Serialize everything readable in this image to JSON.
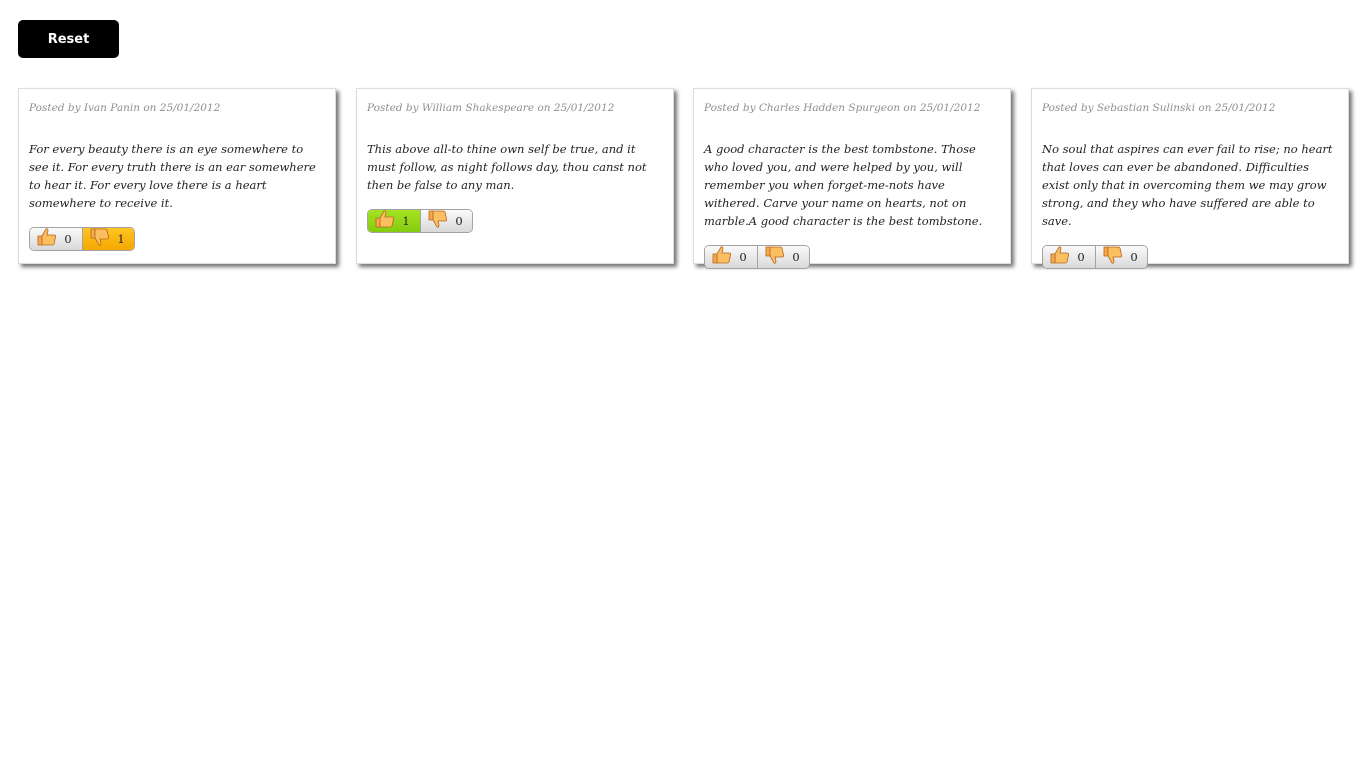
{
  "reset": {
    "label": "Reset"
  },
  "posts": [
    {
      "meta": "Posted by Ivan Panin on 25/01/2012",
      "text": "For every beauty there is an eye somewhere to see it. For every truth there is an ear somewhere to hear it. For every love there is a heart somewhere to receive it.",
      "likes": "0",
      "dislikes": "1",
      "active_vote": "down"
    },
    {
      "meta": "Posted by William Shakespeare on 25/01/2012",
      "text": "This above all-to thine own self be true, and it must follow, as night follows day, thou canst not then be false to any man.",
      "likes": "1",
      "dislikes": "0",
      "active_vote": "up"
    },
    {
      "meta": "Posted by Charles Hadden Spurgeon on 25/01/2012",
      "text": "A good character is the best tombstone. Those who loved you, and were helped by you, will remember you when forget-me-nots have withered. Carve your name on hearts, not on marble.A good character is the best tombstone.",
      "likes": "0",
      "dislikes": "0",
      "active_vote": "none"
    },
    {
      "meta": "Posted by Sebastian Sulinski on 25/01/2012",
      "text": "No soul that aspires can ever fail to rise; no heart that loves can ever be abandoned. Difficulties exist only that in overcoming them we may grow strong, and they who have suffered are able to save.",
      "likes": "0",
      "dislikes": "0",
      "active_vote": "none"
    }
  ],
  "icons": {
    "like": "thumbs-up-icon",
    "dislike": "thumbs-down-icon"
  },
  "colors": {
    "reset_bg": "#000000",
    "like_active": "#99dc1a",
    "dislike_active": "#fbb815",
    "hand": "#f6a94a"
  }
}
